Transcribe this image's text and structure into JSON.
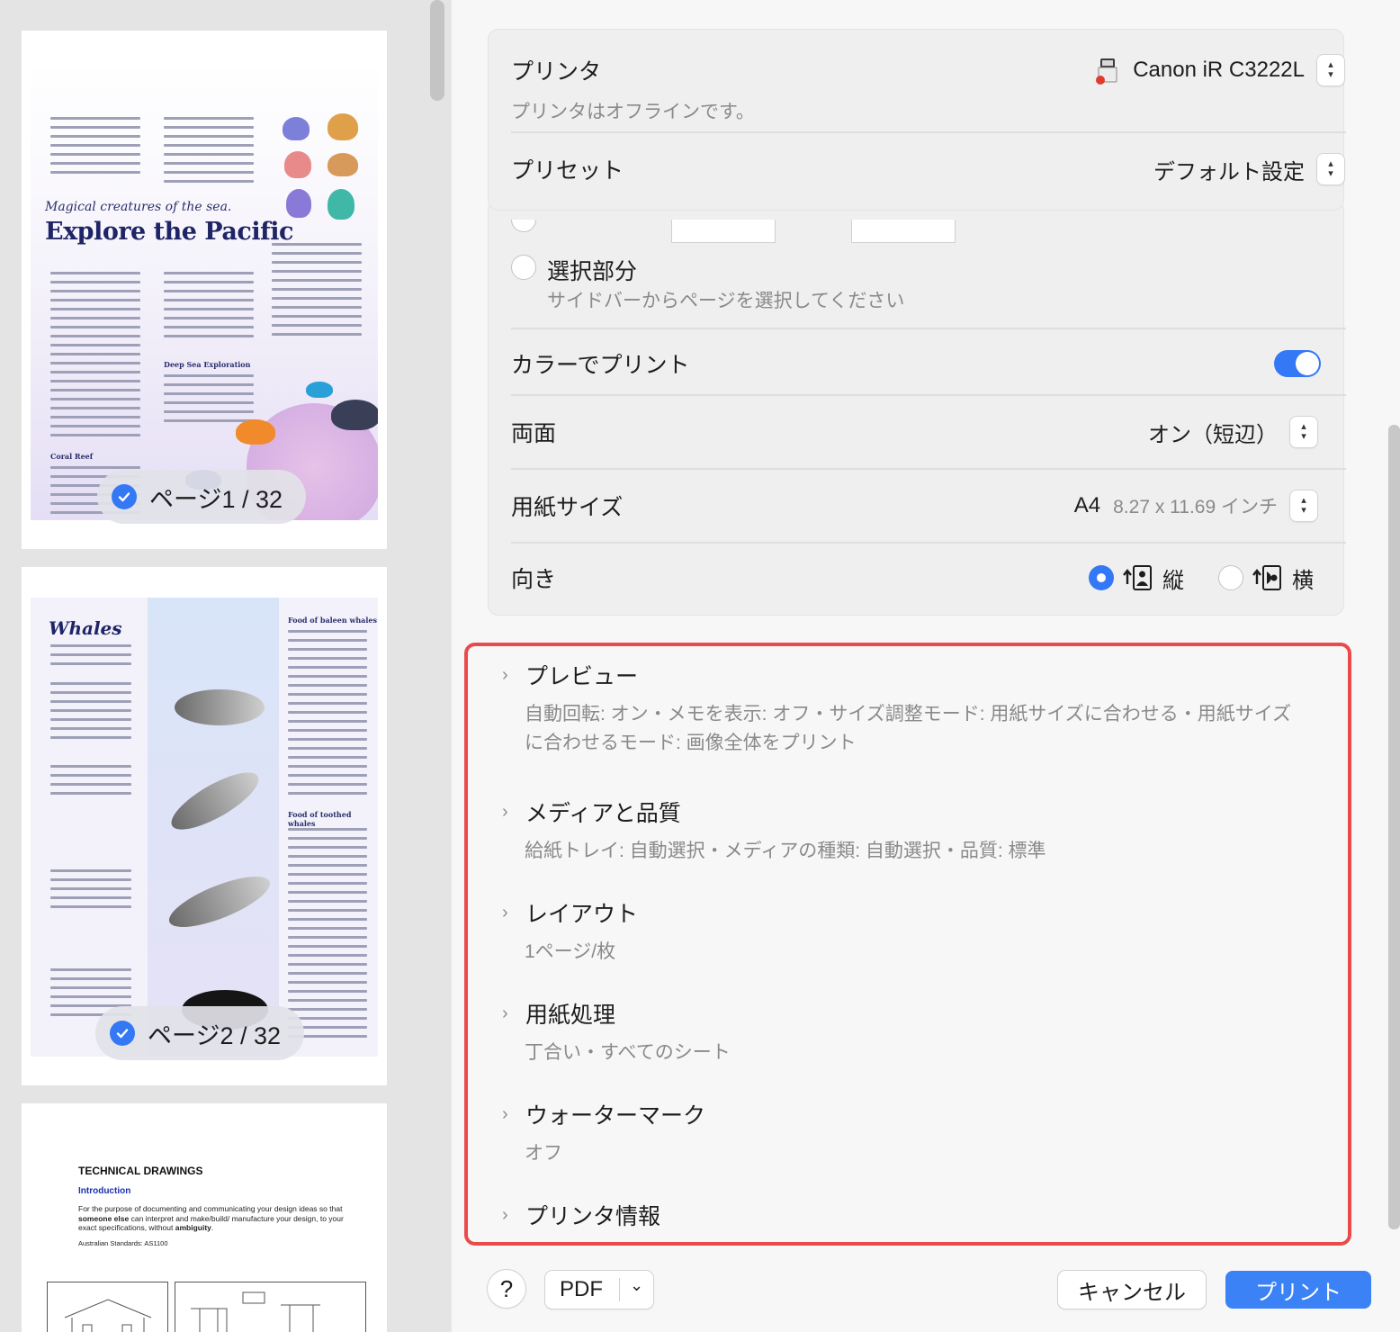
{
  "sidebar": {
    "pages": [
      {
        "badge": "ページ1 / 32",
        "subtitle": "Magical creatures of the sea.",
        "title": "Explore the Pacific",
        "headings": [
          "Coral Reef",
          "Deep Sea Exploration"
        ]
      },
      {
        "badge": "ページ2 / 32",
        "title": "Whales",
        "headings": [
          "Food of baleen whales",
          "Food of toothed whales"
        ]
      },
      {
        "heading": "TECHNICAL DRAWINGS",
        "intro": "Introduction",
        "body_pre": "For the purpose of documenting and communicating your design ideas so that ",
        "body_em1": "someone else",
        "body_mid": " can interpret and make/build/ manufacture your design, to your exact specifications, without ",
        "body_em2": "ambiguity",
        "body_end": ".",
        "standard": "Australian Standards:  AS1100"
      }
    ]
  },
  "printer_box": {
    "printer_label": "プリンタ",
    "printer_name": "Canon iR C3222L",
    "printer_status": "プリンタはオフラインです。",
    "preset_label": "プリセット",
    "preset_value": "デフォルト設定"
  },
  "range": {
    "selection_label": "選択部分",
    "selection_hint": "サイドバーからページを選択してください"
  },
  "settings": {
    "color_label": "カラーでプリント",
    "color_on": true,
    "duplex_label": "両面",
    "duplex_value": "オン（短辺）",
    "paper_label": "用紙サイズ",
    "paper_value": "A4",
    "paper_dims": "8.27 x 11.69 インチ",
    "orientation_label": "向き",
    "portrait_label": "縦",
    "landscape_label": "横"
  },
  "sections": [
    {
      "title": "プレビュー",
      "desc": "自動回転: オン・メモを表示: オフ・サイズ調整モード: 用紙サイズに合わせる・用紙サイズに合わせるモード: 画像全体をプリント"
    },
    {
      "title": "メディアと品質",
      "desc": "給紙トレイ: 自動選択・メディアの種類: 自動選択・品質: 標準"
    },
    {
      "title": "レイアウト",
      "desc": "1ページ/枚"
    },
    {
      "title": "用紙処理",
      "desc": "丁合い・すべてのシート"
    },
    {
      "title": "ウォーターマーク",
      "desc": "オフ"
    },
    {
      "title": "プリンタ情報",
      "desc": ""
    }
  ],
  "footer": {
    "help_label": "?",
    "pdf_label": "PDF",
    "cancel_label": "キャンセル",
    "print_label": "プリント"
  },
  "colors": {
    "accent": "#3478f6",
    "highlight_border": "#e94b4b"
  }
}
